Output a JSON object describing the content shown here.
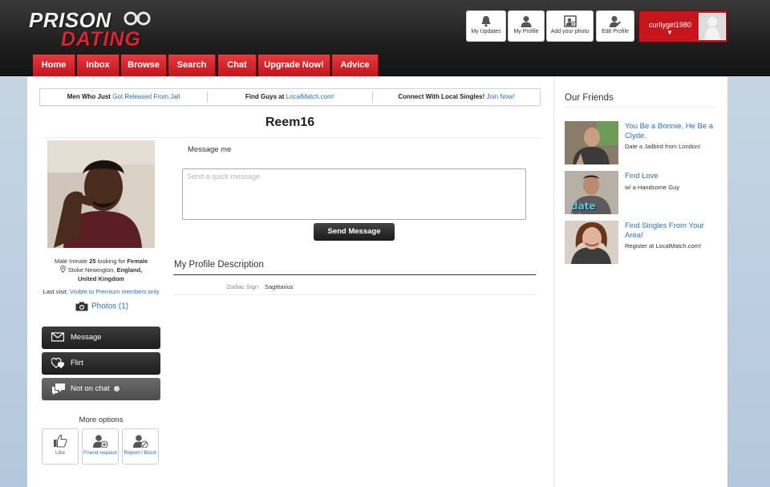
{
  "logo": {
    "line1": "PRISON",
    "line2": "DATING"
  },
  "top_icons": [
    {
      "label": "My Updates",
      "icon": "bell-icon"
    },
    {
      "label": "My Profile",
      "icon": "user-icon"
    },
    {
      "label": "Add your photo",
      "icon": "add-photo-icon"
    },
    {
      "label": "Edit Profile",
      "icon": "edit-profile-icon"
    }
  ],
  "user": {
    "name": "curllygirl1980",
    "caret": "▼"
  },
  "nav": [
    "Home",
    "Inbox",
    "Browse",
    "Search",
    "Chat",
    "Upgrade Now!",
    "Advice"
  ],
  "promo": [
    {
      "text": "Men Who Just ",
      "link": "Got Released From Jail"
    },
    {
      "text": "Find Guys at ",
      "link": "LocalMatch.com!"
    },
    {
      "text": "Connect With Local Singles! ",
      "link": "Join Now!"
    }
  ],
  "profile": {
    "name": "Reem16",
    "info_prefix": "Male Inmate ",
    "age": "25",
    "looking_text": " looking for ",
    "looking_for": "Female",
    "location_town": "Stoke Newington, ",
    "location_region": "England,",
    "location_country": "United Kingdom",
    "last_visit_label": "Last visit: ",
    "last_visit_value": "Visible to Premium members only",
    "photos_label": "Photos (1)"
  },
  "actions": {
    "message": "Message",
    "flirt": "Flirt",
    "chat": "Not on chat",
    "more_options": "More options",
    "like": "Like",
    "friend_request": "Friend request",
    "report_block": "Report / Block"
  },
  "message_form": {
    "label": "Message me",
    "placeholder": "Send a quick message",
    "send_label": "Send Message"
  },
  "description": {
    "title": "My Profile Description",
    "zodiac_label": "Zodiac Sign",
    "zodiac_value": "Sagittarius"
  },
  "sidebar": {
    "title": "Our Friends",
    "friends": [
      {
        "title": "You Be a Bonnie, He Be a Clyde.",
        "subtitle": "Date a Jailbird from London!"
      },
      {
        "title": "Find Love",
        "subtitle": "w/ a Handsome Guy",
        "overlay": "date him"
      },
      {
        "title": "Find Singles From Your Area!",
        "subtitle": "Register at LocalMatch.com!"
      }
    ]
  },
  "colors": {
    "brand_red": "#c4161c",
    "link_blue": "#2a6fb5",
    "dark_button": "#1d1d1d"
  }
}
